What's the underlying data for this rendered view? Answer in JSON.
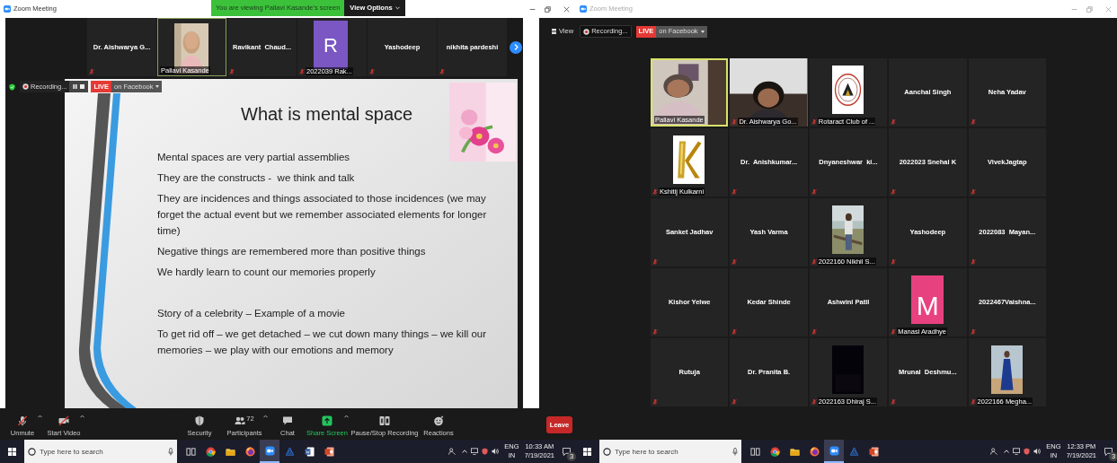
{
  "left_window": {
    "title": "Zoom Meeting",
    "banner": "You are viewing Pallavi Kasande's screen",
    "view_options": "View Options",
    "strip": [
      {
        "kind": "name",
        "name": "Dr. Aishwarya G...",
        "muted": true,
        "active": false
      },
      {
        "name": "Pallavi Kasande",
        "muted": false,
        "active": true
      },
      {
        "kind": "name",
        "name": "Ravikant  Chaud...",
        "muted": true,
        "active": false
      },
      {
        "kind": "avatar",
        "letter": "R",
        "color": "#7b57c4",
        "name": "2022039 Rak...",
        "muted": true,
        "active": false
      },
      {
        "kind": "name",
        "name": "Yashodeep",
        "muted": true,
        "active": false
      },
      {
        "kind": "name",
        "name": "nikhita pardeshi",
        "muted": true,
        "active": false
      }
    ],
    "recording": {
      "label": "Recording...",
      "live": "LIVE",
      "stream": "on Facebook"
    },
    "slide": {
      "title": "What is mental space",
      "groups": [
        [
          "Mental spaces are very partial assemblies",
          "They are the constructs -  we think and talk",
          "They are incidences and things associated to those incidences (we may forget the actual event but we remember associated elements for longer time)",
          "Negative things are remembered more than positive things",
          "We hardly learn to count our memories properly"
        ],
        [
          "Story of a celebrity – Example of a movie",
          "To get rid off – we get detached – we cut down many things – we kill our memories – we play with our emotions and memory"
        ]
      ]
    },
    "controls": [
      {
        "kind": "mic",
        "label": "Unmute",
        "menu": true
      },
      {
        "kind": "camera",
        "label": "Start Video",
        "menu": true
      },
      {
        "kind": "security",
        "label": "Security",
        "menu": false
      },
      {
        "kind": "participants",
        "label": "Participants",
        "count": "72",
        "menu": true
      },
      {
        "kind": "chat",
        "label": "Chat",
        "menu": false
      },
      {
        "kind": "share",
        "label": "Share Screen",
        "menu": true
      },
      {
        "kind": "record",
        "label": "Pause/Stop Recording",
        "menu": false
      },
      {
        "kind": "reactions",
        "label": "Reactions",
        "menu": false
      }
    ]
  },
  "right_window": {
    "title": "Zoom Meeting",
    "toolbar": {
      "view": "View",
      "recording": "Recording...",
      "live": "LIVE",
      "stream": "on Facebook"
    },
    "tiles": [
      {
        "kind": "video",
        "name": "Pallavi Kasande",
        "muted": false,
        "active": true
      },
      {
        "kind": "video",
        "name": "Dr. Aishwarya Go...",
        "muted": true,
        "active": false
      },
      {
        "name": "Rotaract Club of ...",
        "muted": true,
        "active": false
      },
      {
        "kind": "name",
        "name": "Aanchal Singh",
        "muted": true,
        "active": false
      },
      {
        "kind": "name",
        "name": "Neha Yadav",
        "muted": true,
        "active": false
      },
      {
        "name": "Kshitij Kulkarni",
        "muted": true,
        "active": false
      },
      {
        "kind": "name",
        "name": "Dr.  Anishkumar...",
        "muted": true,
        "active": false
      },
      {
        "kind": "name",
        "name": "Dnyaneshwar  ki...",
        "muted": true,
        "active": false
      },
      {
        "kind": "name",
        "name": "2022023 Snehal K",
        "muted": true,
        "active": false
      },
      {
        "kind": "name",
        "name": "VivekJagtap",
        "muted": true,
        "active": false
      },
      {
        "kind": "name",
        "name": "Sanket Jadhav",
        "muted": true,
        "active": false
      },
      {
        "kind": "name",
        "name": "Yash Varma",
        "muted": true,
        "active": false
      },
      {
        "name": "2022160 Nikhil S...",
        "muted": true,
        "active": false
      },
      {
        "kind": "name",
        "name": "Yashodeep",
        "muted": true,
        "active": false
      },
      {
        "kind": "name",
        "name": "2022083  Mayan...",
        "muted": true,
        "active": false
      },
      {
        "kind": "name",
        "name": "Kishor Yelwe",
        "muted": true,
        "active": false
      },
      {
        "kind": "name",
        "name": "Kedar Shinde",
        "muted": true,
        "active": false
      },
      {
        "kind": "name",
        "name": "Ashwini Patil",
        "muted": true,
        "active": false
      },
      {
        "kind": "avatar",
        "letter": "M",
        "color": "#e8417f",
        "name": "Manasi Aradhye",
        "muted": true,
        "active": false
      },
      {
        "kind": "name",
        "name": "2022467Vaishna...",
        "muted": true,
        "active": false
      },
      {
        "kind": "name",
        "name": "Rutuja",
        "muted": true,
        "active": false
      },
      {
        "kind": "name",
        "name": "Dr. Pranita B.",
        "muted": true,
        "active": false
      },
      {
        "name": "2022163 Dhiraj S...",
        "muted": true,
        "active": false
      },
      {
        "kind": "name",
        "name": "Mrunal  Deshmu...",
        "muted": true,
        "active": false
      },
      {
        "name": "2022166 Megha...",
        "muted": true,
        "active": false
      }
    ],
    "leave": "Leave"
  },
  "left_taskbar": {
    "search": {
      "placeholder": "Type here to search"
    },
    "apps": [
      {
        "kind": "taskview",
        "selected": false
      },
      {
        "kind": "chrome",
        "selected": false
      },
      {
        "kind": "files",
        "selected": false
      },
      {
        "kind": "firefox",
        "selected": false
      },
      {
        "kind": "zoom",
        "selected": true
      },
      {
        "kind": "app",
        "selected": false
      },
      {
        "kind": "word",
        "selected": false
      },
      {
        "kind": "powerpoint",
        "selected": false
      }
    ],
    "lang": "ENG",
    "region": "IN",
    "time": "10:33 AM",
    "date": "7/19/2021",
    "notifications": "3"
  },
  "right_taskbar": {
    "search": {
      "placeholder": "Type here to search"
    },
    "apps": [
      {
        "kind": "taskview",
        "selected": false
      },
      {
        "kind": "chrome",
        "selected": false
      },
      {
        "kind": "files",
        "selected": false
      },
      {
        "kind": "firefox",
        "selected": false
      },
      {
        "kind": "zoom",
        "selected": true
      },
      {
        "kind": "app",
        "selected": false
      },
      {
        "kind": "powerpoint",
        "selected": false
      }
    ],
    "lang": "ENG",
    "region": "IN",
    "time": "12:33 PM",
    "date": "7/19/2021",
    "notifications": "3"
  }
}
